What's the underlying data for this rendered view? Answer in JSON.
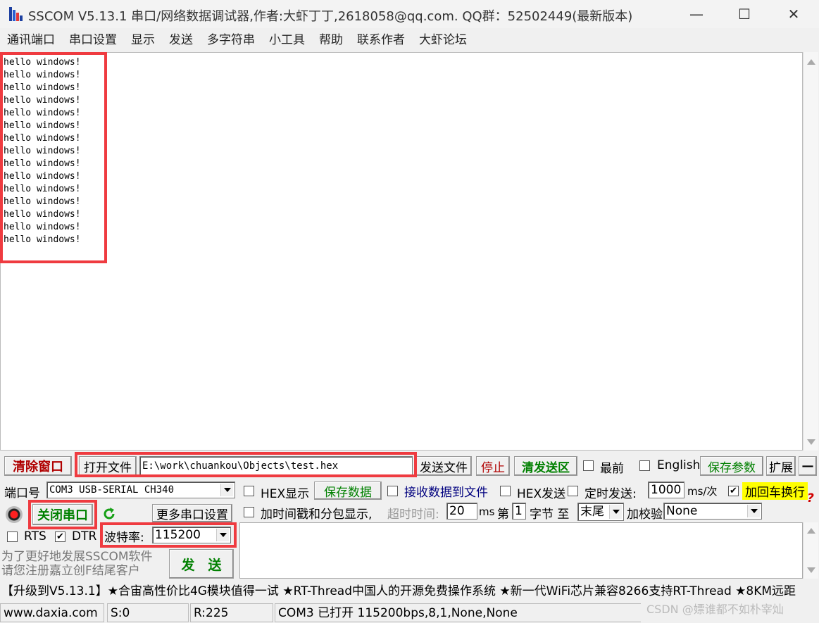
{
  "window": {
    "title": "SSCOM V5.13.1 串口/网络数据调试器,作者:大虾丁丁,2618058@qq.com. QQ群：52502449(最新版本)",
    "minimize_glyph": "—",
    "maximize_glyph": "☐",
    "close_glyph": "✕"
  },
  "menu": [
    "通讯端口",
    "串口设置",
    "显示",
    "发送",
    "多字符串",
    "小工具",
    "帮助",
    "联系作者",
    "大虾论坛"
  ],
  "receive": {
    "lines": [
      "hello windows!",
      "hello windows!",
      "hello windows!",
      "hello windows!",
      "hello windows!",
      "hello windows!",
      "hello windows!",
      "hello windows!",
      "hello windows!",
      "hello windows!",
      "hello windows!",
      "hello windows!",
      "hello windows!",
      "hello windows!",
      "hello windows!"
    ]
  },
  "toolbar": {
    "clear_window": "清除窗口",
    "open_file": "打开文件",
    "file_path": "E:\\work\\chuankou\\Objects\\test.hex",
    "send_file": "发送文件",
    "stop": "停止",
    "clear_send": "清发送区",
    "topmost": "最前",
    "english": "English",
    "save_params": "保存参数",
    "expand": "扩展",
    "collapse": "—"
  },
  "port": {
    "port_label": "端口号",
    "port_value": "COM3 USB-SERIAL CH340",
    "close_port": "关闭串口",
    "more_settings": "更多串口设置",
    "rts": "RTS",
    "dtr": "DTR",
    "baud_label": "波特率:",
    "baud_value": "115200",
    "promo1": "为了更好地发展SSCOM软件",
    "promo2": "请您注册嘉立创F结尾客户"
  },
  "options": {
    "hex_display": "HEX显示",
    "save_data": "保存数据",
    "recv_to_file": "接收数据到文件",
    "hex_send": "HEX发送",
    "timed_send": "定时发送:",
    "interval": "1000",
    "interval_unit": "ms/次",
    "add_crlf": "加回车换行",
    "add_timestamp": "加时间戳和分包显示,",
    "timeout_label": "超时时间:",
    "timeout_value": "20",
    "timeout_unit": "ms",
    "byte_label_1": "第",
    "byte_from": "1",
    "byte_label_2": "字节 至",
    "byte_to": "末尾",
    "checksum_label": "加校验",
    "checksum_value": "None",
    "help_glyph": "?"
  },
  "send_button": "发　送",
  "ticker": "【升级到V5.13.1】★合宙高性价比4G模块值得一试 ★RT-Thread中国人的开源免费操作系统 ★新一代WiFi芯片兼容8266支持RT-Thread ★8KM远距",
  "statusbar": {
    "site": "www.daxia.com",
    "sent": "S:0",
    "received": "R:225",
    "port_status": "COM3 已打开  115200bps,8,1,None,None"
  },
  "watermark": "CSDN @嫖谁都不如朴宰灿",
  "colors": {
    "highlight_red": "#ef3b40",
    "clear_window_text": "#b00000",
    "green_text": "#008000",
    "navy_text": "#00007f",
    "yellow_highlight": "#ffff00"
  }
}
